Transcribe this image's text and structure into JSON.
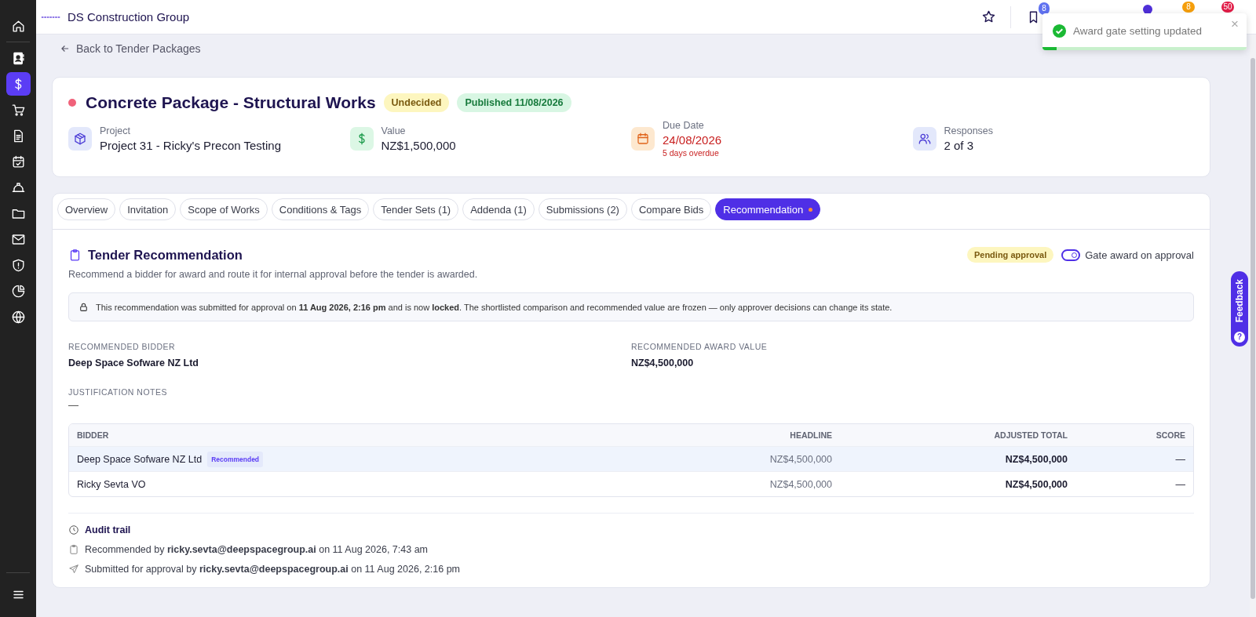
{
  "sidebar": {
    "items": [
      {
        "selected": false
      },
      {
        "selected": false
      },
      {
        "selected": true
      },
      {
        "selected": false
      },
      {
        "selected": false
      },
      {
        "selected": false
      },
      {
        "selected": false
      },
      {
        "selected": false
      },
      {
        "selected": false
      },
      {
        "selected": false
      },
      {
        "selected": false
      },
      {
        "selected": false
      }
    ]
  },
  "header": {
    "company": "DS Construction Group",
    "bookmark_badge": "8",
    "badges": [
      {
        "text": "8",
        "color": "#f59e0b"
      },
      {
        "text": "50",
        "color": "#e11d48"
      }
    ]
  },
  "toast": {
    "message": "Award gate setting updated",
    "close": "×",
    "level": 0.07
  },
  "back_link": "Back to Tender Packages",
  "package": {
    "title": "Concrete Package - Structural Works",
    "badges": [
      {
        "text": "Undecided",
        "kind": "warning"
      },
      {
        "text": "Published 11/08/2026",
        "kind": "success"
      }
    ],
    "stats": [
      {
        "label": "Project",
        "value": "Project 31 - Ricky's Precon Testing",
        "overdue": false
      },
      {
        "label": "Value",
        "value": "NZ$1,500,000",
        "overdue": false
      },
      {
        "label": "Due Date",
        "value": "24/08/2026",
        "note": "5 days overdue",
        "overdue": true
      },
      {
        "label": "Responses",
        "value": "2 of 3",
        "overdue": false
      }
    ]
  },
  "tabs": [
    {
      "label": "Overview",
      "selected": false,
      "dot": false
    },
    {
      "label": "Invitation",
      "selected": false,
      "dot": false
    },
    {
      "label": "Scope of Works",
      "selected": false,
      "dot": false
    },
    {
      "label": "Conditions & Tags",
      "selected": false,
      "dot": false
    },
    {
      "label": "Tender Sets (1)",
      "selected": false,
      "dot": false
    },
    {
      "label": "Addenda (1)",
      "selected": false,
      "dot": false
    },
    {
      "label": "Submissions (2)",
      "selected": false,
      "dot": false
    },
    {
      "label": "Compare Bids",
      "selected": false,
      "dot": false
    },
    {
      "label": "Recommendation",
      "selected": true,
      "dot": true
    }
  ],
  "recommendation": {
    "title": "Tender Recommendation",
    "description": "Recommend a bidder for award and route it for internal approval before the tender is awarded.",
    "status": "Pending approval",
    "gate_toggle": {
      "label": "Gate award on approval",
      "on": true
    },
    "notice": "This recommendation was submitted for approval on **11 Aug 2026, 2:16 pm** and is now **locked**. The shortlisted comparison and recommended value are frozen — only approver decisions can change its state.",
    "fields": [
      {
        "label": "RECOMMENDED BIDDER",
        "value": "Deep Space Sofware NZ Ltd"
      },
      {
        "label": "RECOMMENDED AWARD VALUE",
        "value": "NZ$4,500,000"
      }
    ],
    "notes": {
      "label": "JUSTIFICATION NOTES",
      "value": "—"
    },
    "table": {
      "columns": [
        "BIDDER",
        "HEADLINE",
        "ADJUSTED TOTAL",
        "SCORE"
      ],
      "rows": [
        {
          "bidder": "Deep Space Sofware NZ Ltd",
          "badge": "Recommended",
          "headline": "NZ$4,500,000",
          "adjusted_total": "NZ$4,500,000",
          "score": "—",
          "selected": true
        },
        {
          "bidder": "Ricky Sevta VO",
          "headline": "NZ$4,500,000",
          "adjusted_total": "NZ$4,500,000",
          "score": "—",
          "selected": false
        }
      ]
    },
    "audit": {
      "title": "Audit trail",
      "entries": [
        {
          "kind": "recommended",
          "text": "Recommended by **ricky.sevta@deepspacegroup.ai** on 11 Aug 2026, 7:43 am"
        },
        {
          "kind": "submitted",
          "text": "Submitted for approval by **ricky.sevta@deepspacegroup.ai** on 11 Aug 2026, 2:16 pm"
        }
      ]
    }
  },
  "feedback": {
    "label": "Feedback",
    "help": "?"
  }
}
